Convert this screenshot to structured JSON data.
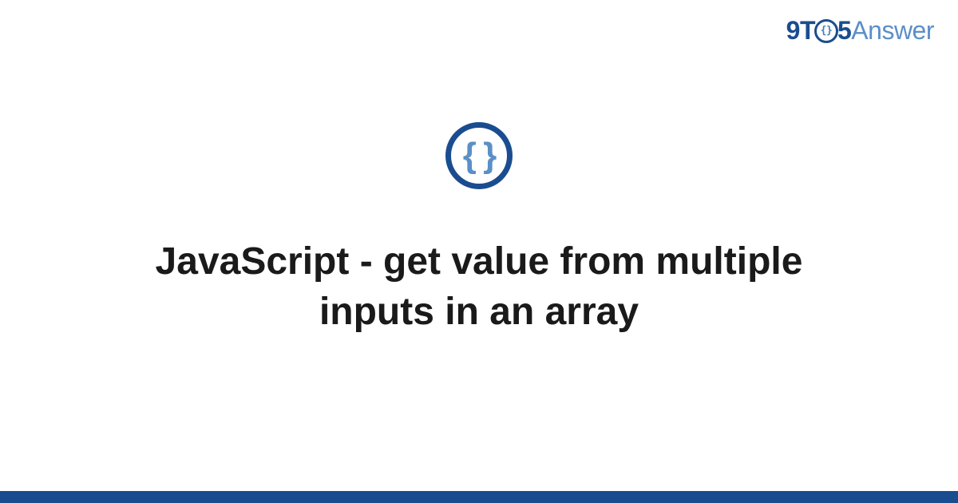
{
  "logo": {
    "part1": "9",
    "part2": "T",
    "part_o_inner": "{}",
    "part3": "5",
    "part4": "Answer"
  },
  "icon": {
    "braces_text": "{ }"
  },
  "title": "JavaScript - get value from multiple inputs in an array",
  "colors": {
    "primary": "#1a4d8f",
    "accent": "#5b8fc7"
  }
}
